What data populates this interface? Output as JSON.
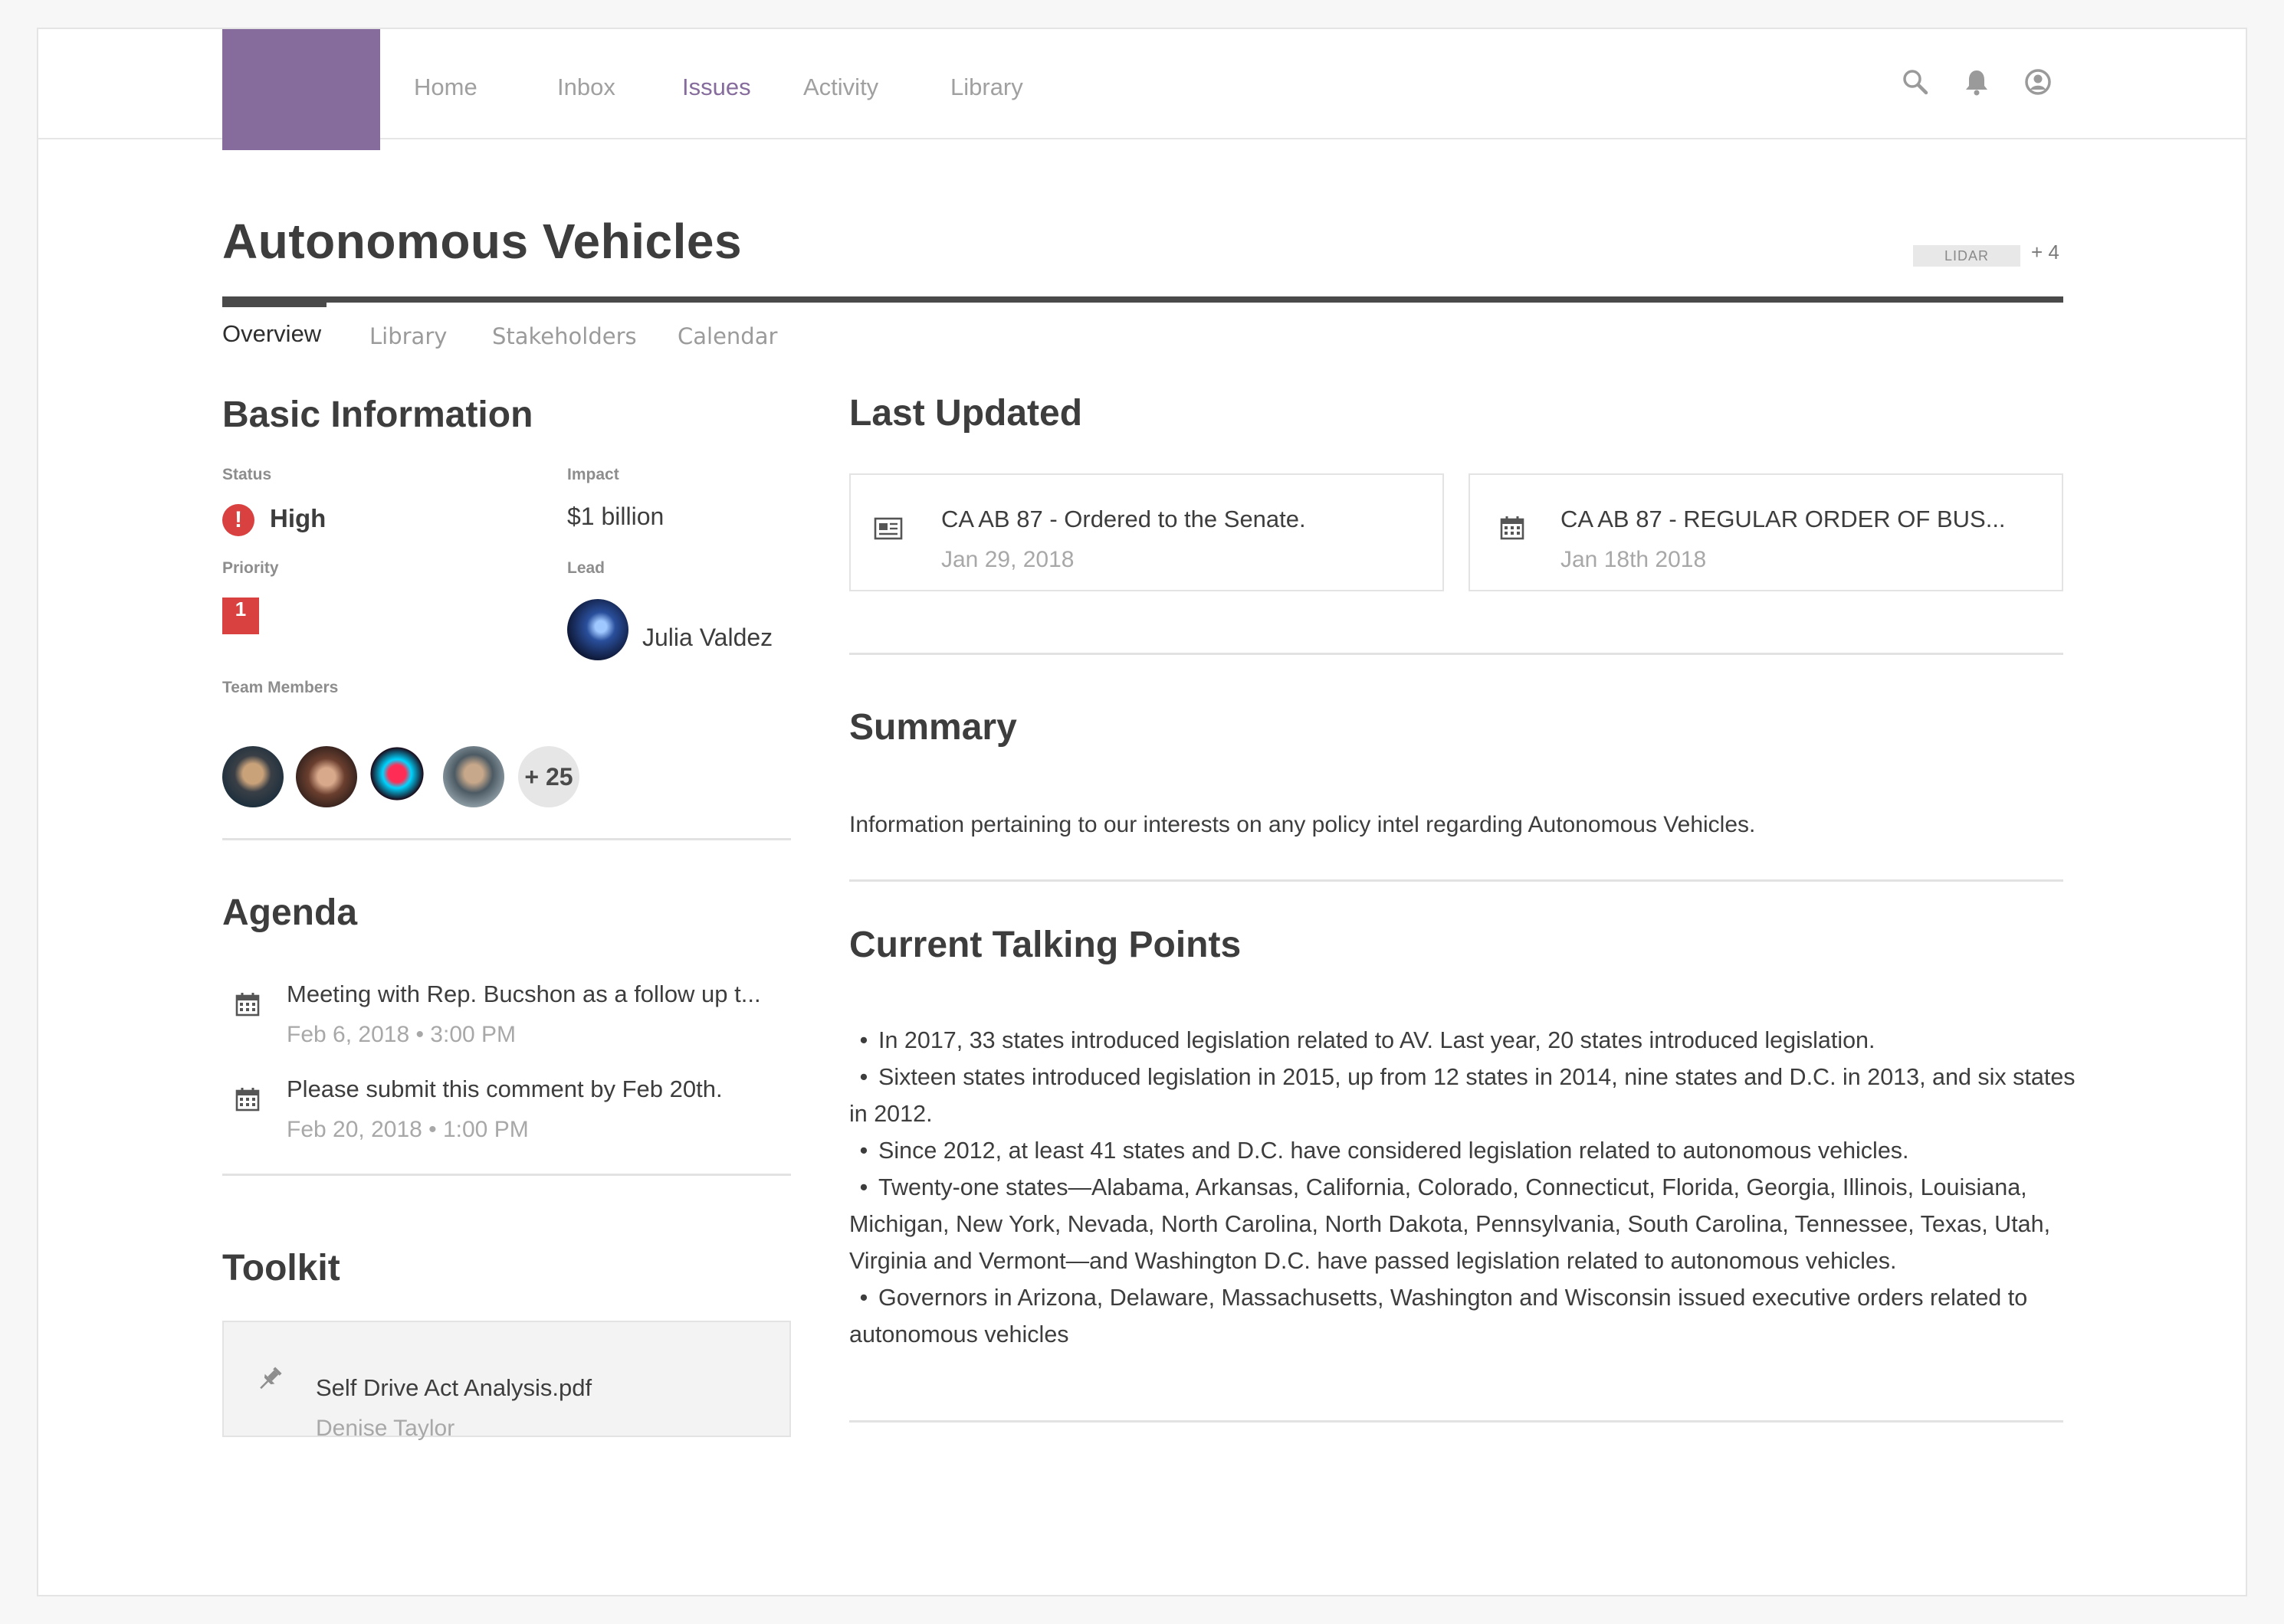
{
  "nav": {
    "items": [
      {
        "label": "Home"
      },
      {
        "label": "Inbox"
      },
      {
        "label": "Issues"
      },
      {
        "label": "Activity"
      },
      {
        "label": "Library"
      }
    ],
    "active": "Issues",
    "icons": [
      "search-icon",
      "bell-icon",
      "user-icon"
    ],
    "brand_color": "#866c9c"
  },
  "page": {
    "title": "Autonomous Vehicles",
    "tag": "LIDAR",
    "tag_more": "+ 4"
  },
  "tabs": [
    {
      "label": "Overview"
    },
    {
      "label": "Library"
    },
    {
      "label": "Stakeholders"
    },
    {
      "label": "Calendar"
    }
  ],
  "basic_info": {
    "heading": "Basic Information",
    "status_label": "Status",
    "status_value": "High",
    "status_icon_glyph": "!",
    "impact_label": "Impact",
    "impact_value": "$1 billion",
    "priority_label": "Priority",
    "priority_value": "1",
    "lead_label": "Lead",
    "lead_name": "Julia Valdez",
    "team_label": "Team Members",
    "team_more": "+ 25",
    "status_color": "#d8413f"
  },
  "agenda": {
    "heading": "Agenda",
    "items": [
      {
        "title": "Meeting with Rep. Bucshon as a follow up t...",
        "meta": "Feb 6, 2018 • 3:00 PM"
      },
      {
        "title": "Please submit this comment by Feb 20th.",
        "meta": "Feb 20, 2018 • 1:00 PM"
      }
    ]
  },
  "toolkit": {
    "heading": "Toolkit",
    "file": "Self Drive Act Analysis.pdf",
    "owner": "Denise Taylor"
  },
  "last_updated": {
    "heading": "Last Updated",
    "cards": [
      {
        "title": "CA AB 87 - Ordered to the Senate.",
        "date": "Jan 29, 2018",
        "icon": "newspaper-icon"
      },
      {
        "title": "CA AB 87 - REGULAR ORDER OF BUS...",
        "date": "Jan 18th 2018",
        "icon": "calendar-icon"
      }
    ]
  },
  "summary": {
    "heading": "Summary",
    "text": "Information pertaining to our interests on any policy intel regarding Autonomous Vehicles."
  },
  "talking_points": {
    "heading": "Current Talking Points",
    "bullet": "•",
    "items": [
      "In 2017, 33 states introduced legislation related to AV. Last year, 20 states introduced legislation.",
      "Sixteen states introduced legislation in 2015, up from 12 states in 2014, nine states and D.C. in 2013, and six states in 2012.",
      "Since 2012, at least 41 states and D.C. have considered legislation related to autonomous vehicles.",
      "Twenty-one states—Alabama, Arkansas, California, Colorado, Connecticut, Florida, Georgia, Illinois, Louisiana, Michigan, New York, Nevada, North Carolina, North Dakota, Pennsylvania, South Carolina, Tennessee, Texas, Utah, Virginia and Vermont—and Washington D.C. have passed legislation related to autonomous vehicles.",
      "Governors in Arizona, Delaware, Massachusetts, Washington and Wisconsin issued executive orders related to autonomous vehicles"
    ]
  }
}
